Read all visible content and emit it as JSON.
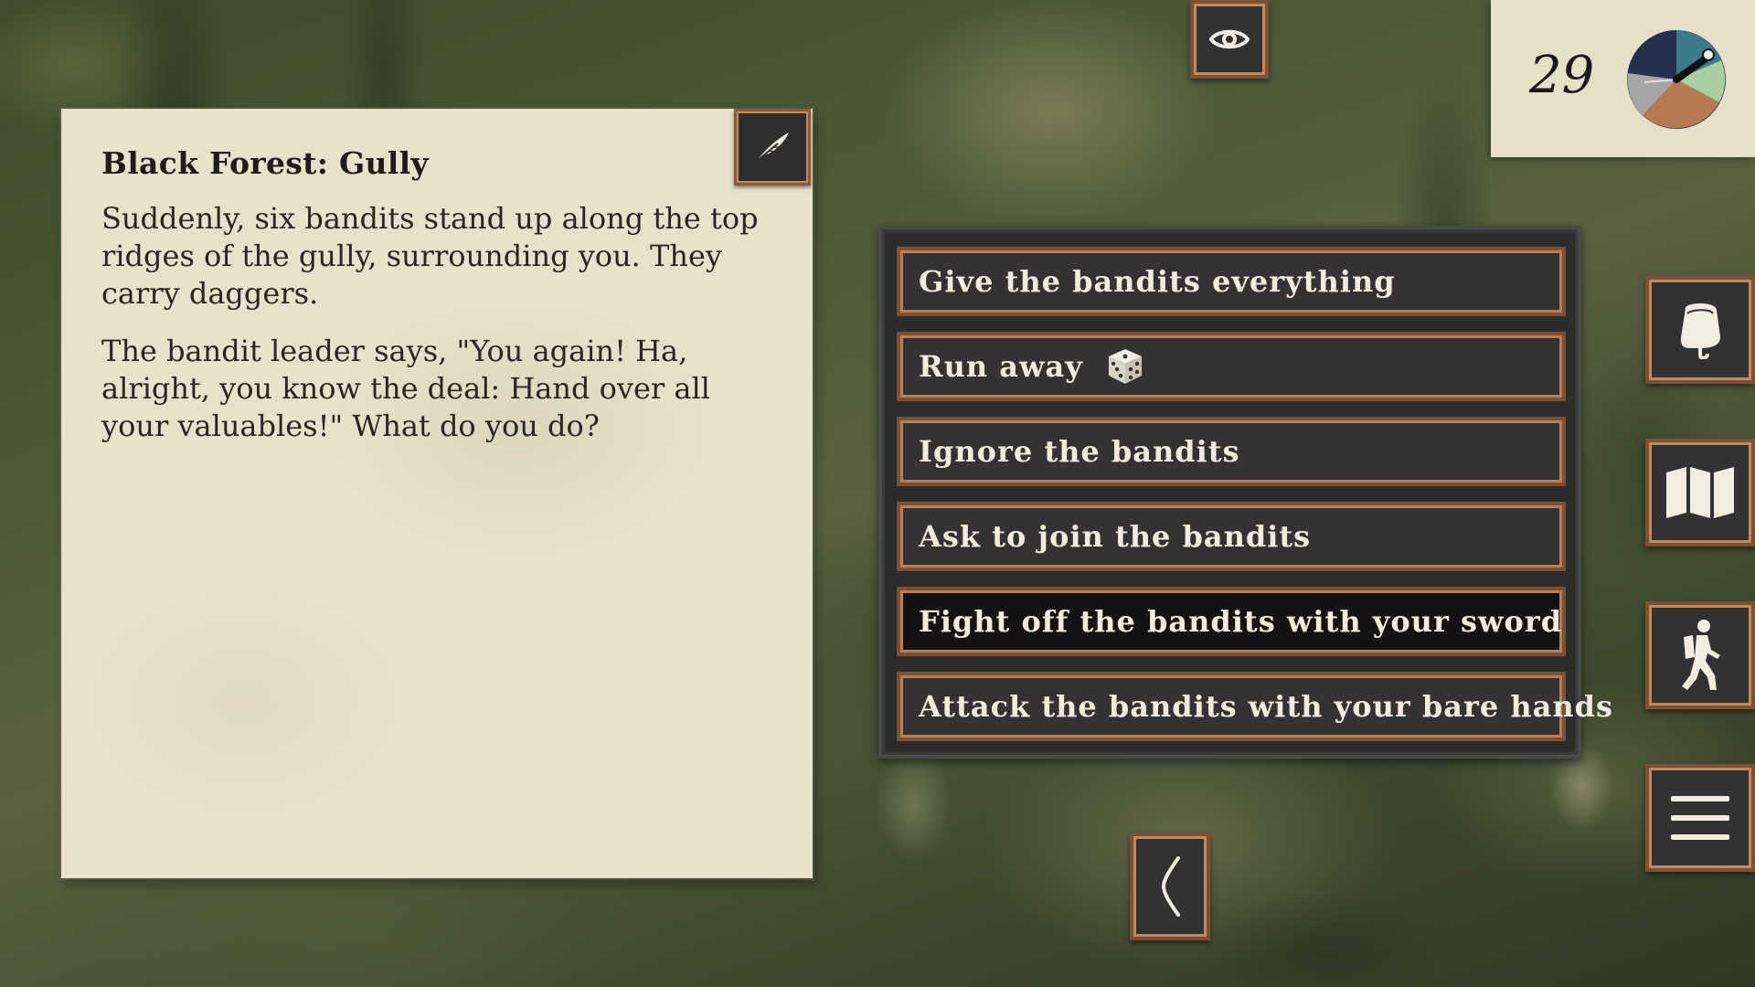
{
  "story": {
    "title": "Black Forest: Gully",
    "paragraphs": [
      "Suddenly, six bandits stand up along the top ridges of the gully, surrounding you. They carry daggers.",
      "The bandit leader says, \"You again! Ha, alright, you know the deal: Hand over all your valuables!\" What do you do?"
    ]
  },
  "status": {
    "day_counter": "29"
  },
  "choices": [
    {
      "label": "Give the bandits everything"
    },
    {
      "label": "Run away",
      "icon": "dice-icon"
    },
    {
      "label": "Ignore the bandits"
    },
    {
      "label": "Ask to join the bandits"
    },
    {
      "label": "Fight off the bandits with your sword",
      "selected": true
    },
    {
      "label": "Attack the bandits with your bare hands"
    }
  ],
  "side_menu": [
    {
      "icon": "backpack-icon"
    },
    {
      "icon": "map-icon"
    },
    {
      "icon": "hiker-icon"
    },
    {
      "icon": "hamburger-menu-icon"
    }
  ],
  "top_button": {
    "icon": "eye-icon"
  },
  "bottom_button": {
    "icon": "back-chevron-icon"
  }
}
